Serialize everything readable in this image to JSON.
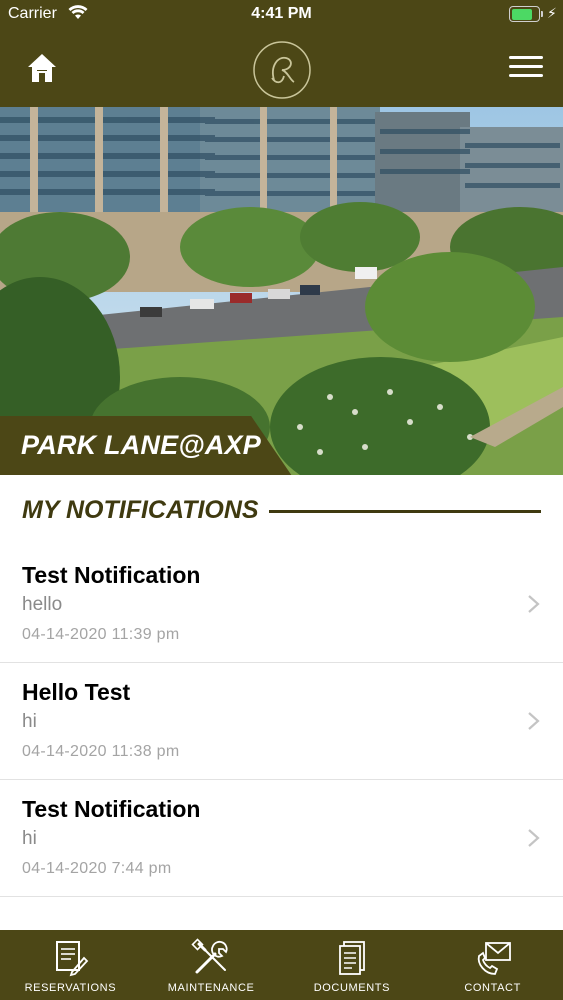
{
  "status_bar": {
    "carrier": "Carrier",
    "time": "4:41 PM",
    "battery_level": 0.8
  },
  "header": {
    "home_icon": "home-icon",
    "logo_icon": "monogram-logo",
    "menu_icon": "hamburger-menu-icon",
    "accent_color": "#4c4716"
  },
  "hero": {
    "property_name": "PARK LANE@AXP"
  },
  "notifications": {
    "heading": "MY NOTIFICATIONS",
    "items": [
      {
        "title": "Test Notification",
        "body": "hello",
        "date": "04-14-2020 11:39 pm"
      },
      {
        "title": "Hello Test",
        "body": "hi",
        "date": "04-14-2020 11:38 pm"
      },
      {
        "title": "Test Notification",
        "body": "hi",
        "date": "04-14-2020 7:44 pm"
      }
    ]
  },
  "tabbar": {
    "tabs": [
      {
        "label": "RESERVATIONS",
        "icon": "reservations-icon"
      },
      {
        "label": "MAINTENANCE",
        "icon": "maintenance-icon"
      },
      {
        "label": "DOCUMENTS",
        "icon": "documents-icon"
      },
      {
        "label": "CONTACT",
        "icon": "contact-icon"
      }
    ]
  }
}
